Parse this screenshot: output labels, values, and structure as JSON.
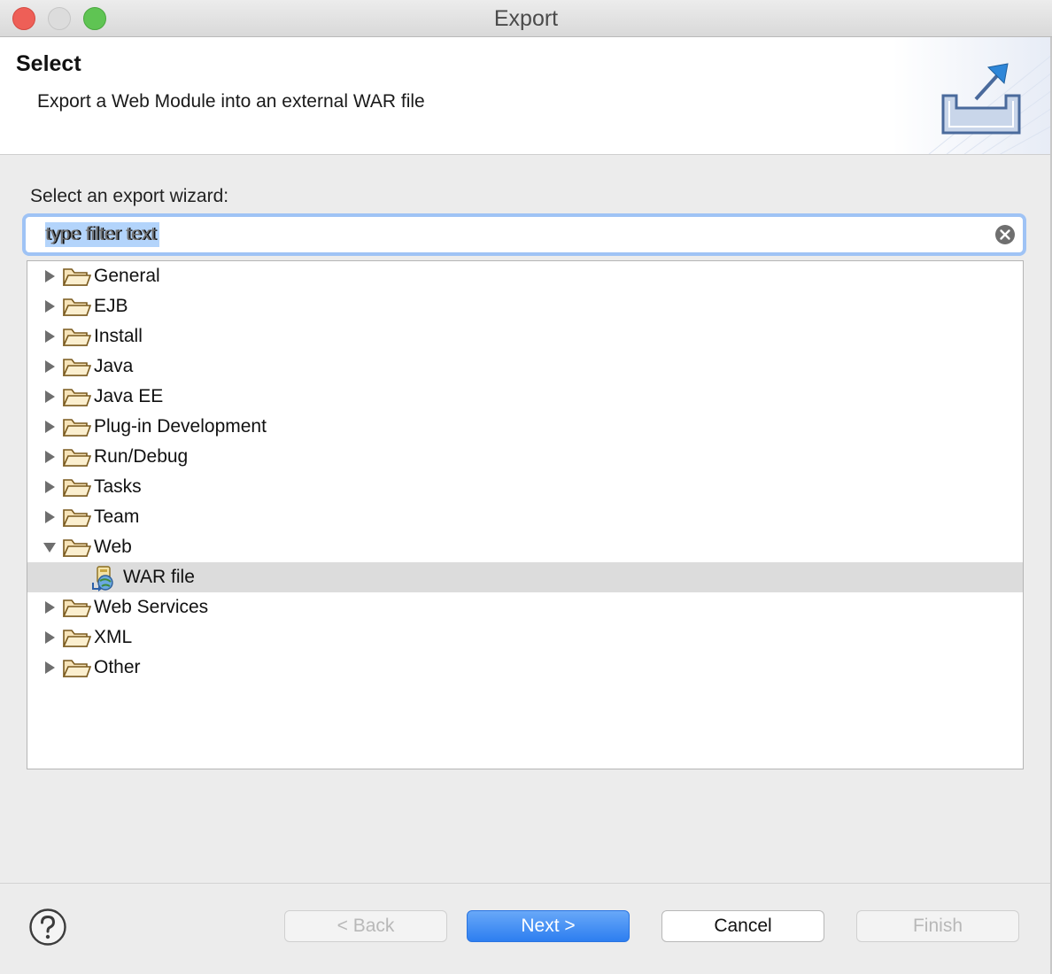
{
  "window": {
    "title": "Export"
  },
  "header": {
    "title": "Select",
    "description": "Export a Web Module into an external WAR file"
  },
  "main": {
    "prompt": "Select an export wizard:",
    "filter": {
      "value": "type filter text",
      "placeholder": "type filter text"
    }
  },
  "tree": {
    "items": [
      {
        "label": "General",
        "expanded": false
      },
      {
        "label": "EJB",
        "expanded": false
      },
      {
        "label": "Install",
        "expanded": false
      },
      {
        "label": "Java",
        "expanded": false
      },
      {
        "label": "Java EE",
        "expanded": false
      },
      {
        "label": "Plug-in Development",
        "expanded": false
      },
      {
        "label": "Run/Debug",
        "expanded": false
      },
      {
        "label": "Tasks",
        "expanded": false
      },
      {
        "label": "Team",
        "expanded": false
      },
      {
        "label": "Web",
        "expanded": true
      },
      {
        "label": "WAR file",
        "child": true,
        "selected": true
      },
      {
        "label": "Web Services",
        "expanded": false
      },
      {
        "label": "XML",
        "expanded": false
      },
      {
        "label": "Other",
        "expanded": false
      }
    ]
  },
  "footer": {
    "back": "< Back",
    "next": "Next >",
    "cancel": "Cancel",
    "finish": "Finish"
  },
  "icons": {
    "folder": "folder-open-icon",
    "twisty_collapsed": "triangle-right-icon",
    "twisty_expanded": "triangle-down-icon",
    "war": "war-file-icon",
    "help": "help-icon",
    "clear": "clear-icon",
    "export": "export-wizard-icon"
  },
  "colors": {
    "accent": "#2d7ef0",
    "selection": "#dcdcdc",
    "filter_highlight": "#b3d4fb",
    "close": "#ee5f57",
    "maximize": "#5fc453"
  }
}
